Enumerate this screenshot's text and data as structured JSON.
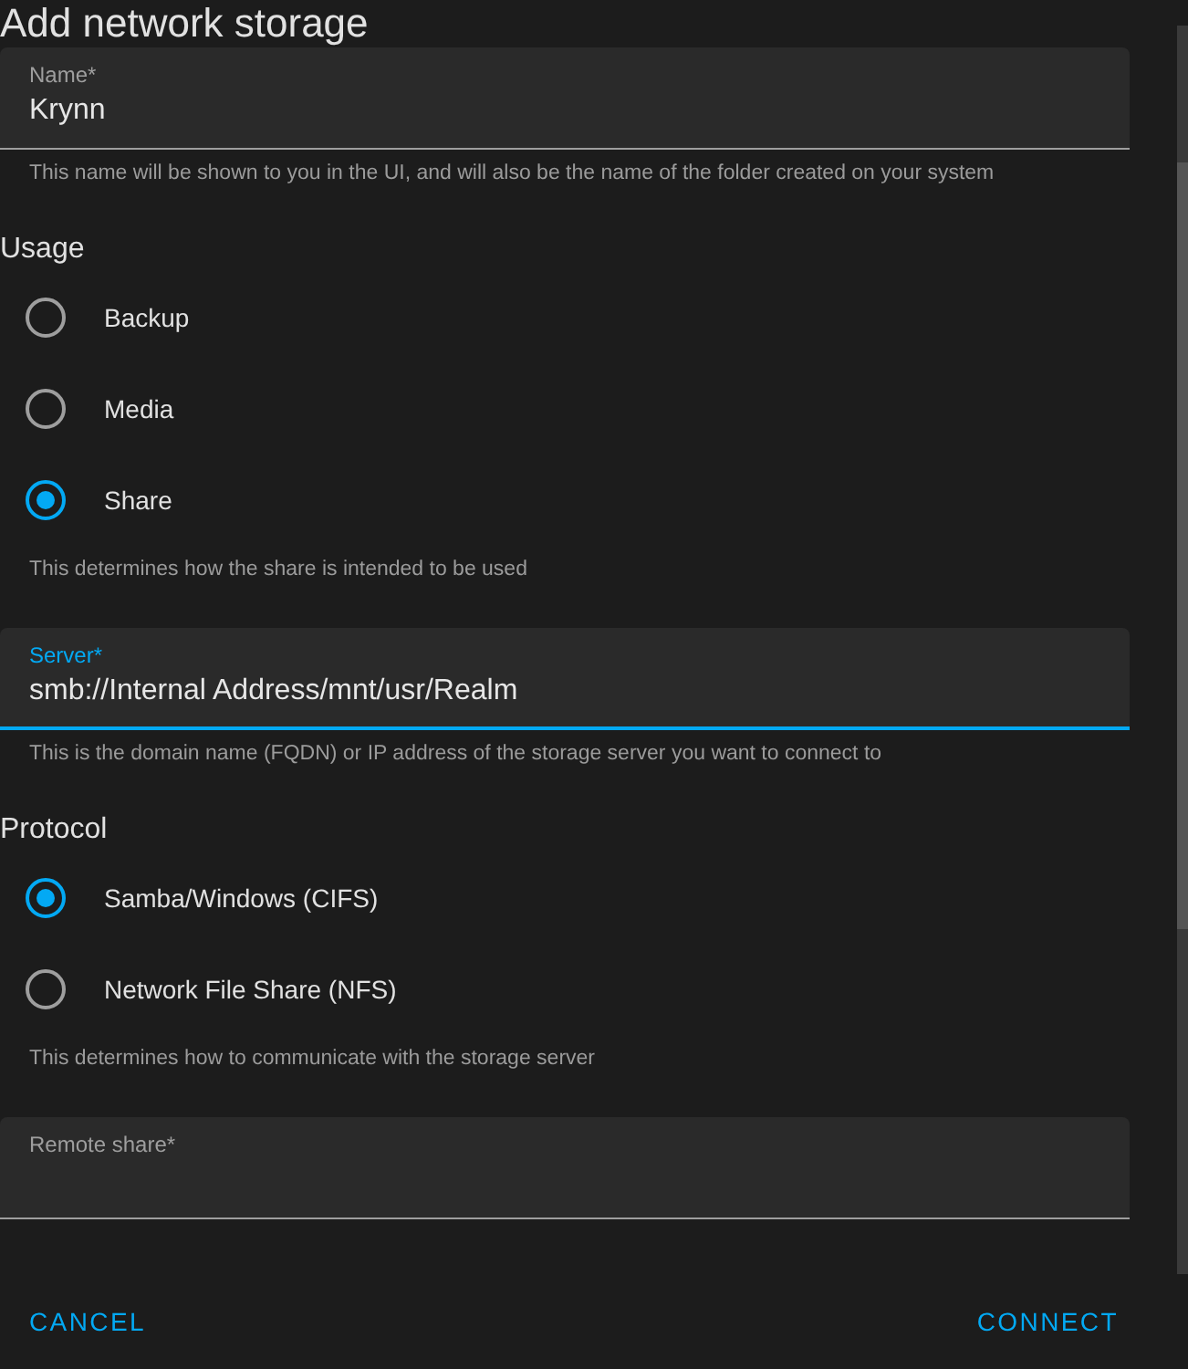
{
  "title": "Add network storage",
  "sections": [
    {
      "kind": "field",
      "label": "Name*",
      "value": "Krynn",
      "focused": false,
      "helper": "This name will be shown to you in the UI, and will also be the name of the folder created on your system"
    },
    {
      "kind": "radio_group",
      "heading": "Usage",
      "options": [
        {
          "label": "Backup",
          "selected": false
        },
        {
          "label": "Media",
          "selected": false
        },
        {
          "label": "Share",
          "selected": true
        }
      ],
      "helper": "This determines how the share is intended to be used"
    },
    {
      "kind": "field",
      "label": "Server*",
      "value": "smb://Internal Address/mnt/usr/Realm",
      "focused": true,
      "helper": "This is the domain name (FQDN) or IP address of the storage server you want to connect to"
    },
    {
      "kind": "radio_group",
      "heading": "Protocol",
      "options": [
        {
          "label": "Samba/Windows (CIFS)",
          "selected": true
        },
        {
          "label": "Network File Share (NFS)",
          "selected": false
        }
      ],
      "helper": "This determines how to communicate with the storage server"
    },
    {
      "kind": "field",
      "label": "Remote share*",
      "focused": false
    }
  ],
  "buttons": [
    {
      "label": "CANCEL"
    },
    {
      "label": "CONNECT"
    }
  ]
}
